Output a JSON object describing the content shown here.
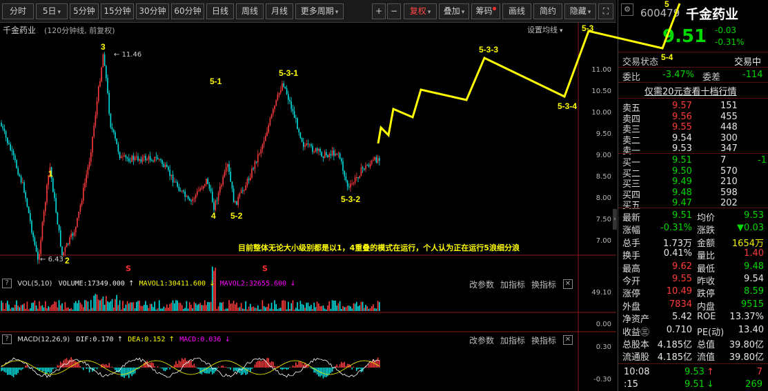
{
  "toolbar": {
    "periods": [
      "分时",
      "5日",
      "5分钟",
      "15分钟",
      "30分钟",
      "60分钟",
      "日线",
      "周线",
      "月线",
      "更多周期"
    ],
    "plus": "+",
    "minus": "−",
    "fuquan": "复权",
    "overlay": "叠加",
    "chips": "筹码",
    "draw": "画线",
    "simple": "简约",
    "hide": "隐藏",
    "expand_icon": "fullscreen-icon"
  },
  "chart": {
    "stock_name": "千金药业",
    "period_note": "(120分钟线, 前复权)",
    "set_ma": "设置均线",
    "price_axis": [
      "11.00",
      "10.50",
      "10.00",
      "9.50",
      "9.00",
      "8.50",
      "8.00",
      "7.50",
      "7.00"
    ],
    "high_label": "11.46",
    "low_label": "6.43",
    "signal_marker": "S",
    "comment": "目前整体无论大小级别都是以1，4重叠的模式在运行，个人认为正在运行5浪细分浪",
    "wave_labels": [
      "1",
      "2",
      "3",
      "4",
      "5",
      "5-1",
      "5-2",
      "5-3",
      "5-3-1",
      "5-3-2",
      "5-3-3",
      "5-3-4",
      "5-4"
    ],
    "line_color": "#ffff00",
    "up_color": "#ff3b3b",
    "down_color": "#00e0e0"
  },
  "vol": {
    "name": "VOL(5,10)",
    "volume_label": "VOLUME:17349.000",
    "mavol1": "MAVOL1:30411.600",
    "mavol2": "MAVOL2:32655.600",
    "axis_top": "49.10",
    "axis_bottom": "0.00",
    "btn_params": "改参数",
    "btn_add": "加指标",
    "btn_switch": "换指标",
    "close": "✕"
  },
  "macd": {
    "name": "MACD(12,26,9)",
    "dif": "DIF:0.170",
    "dea": "DEA:0.152",
    "macd": "MACD:0.036",
    "axis_top": "0.30",
    "axis_bottom": "-0.30",
    "btn_params": "改参数",
    "btn_add": "加指标",
    "btn_switch": "换指标",
    "close": "✕"
  },
  "quote": {
    "code": "600479",
    "name": "千金药业",
    "price": "9.51",
    "change": "-0.03",
    "change_pct": "-0.31%",
    "status_label": "交易状态",
    "status_value": "交易中",
    "weibi_label": "委比",
    "weibi_value": "-3.47%",
    "weicha_label": "委差",
    "weicha_value": "-114",
    "promo": "仅需20元查看十档行情",
    "asks": [
      {
        "label": "卖五",
        "price": "9.57",
        "vol": "151"
      },
      {
        "label": "卖四",
        "price": "9.56",
        "vol": "455"
      },
      {
        "label": "卖三",
        "price": "9.55",
        "vol": "448"
      },
      {
        "label": "卖二",
        "price": "9.54",
        "vol": "300"
      },
      {
        "label": "卖一",
        "price": "9.53",
        "vol": "347"
      }
    ],
    "bids": [
      {
        "label": "买一",
        "price": "9.51",
        "vol": "7",
        "delta": "-1"
      },
      {
        "label": "买二",
        "price": "9.50",
        "vol": "570",
        "delta": ""
      },
      {
        "label": "买三",
        "price": "9.49",
        "vol": "210",
        "delta": ""
      },
      {
        "label": "买四",
        "price": "9.48",
        "vol": "598",
        "delta": ""
      },
      {
        "label": "买五",
        "price": "9.47",
        "vol": "202",
        "delta": ""
      }
    ],
    "stats": [
      {
        "l1": "最新",
        "v1": "9.51",
        "c1": "dn",
        "l2": "均价",
        "v2": "9.53",
        "c2": "dn"
      },
      {
        "l1": "涨幅",
        "v1": "-0.31%",
        "c1": "dn",
        "l2": "涨跌",
        "v2": "▼0.03",
        "c2": "dn"
      },
      {
        "l1": "总手",
        "v1": "1.73万",
        "c1": "wh",
        "l2": "金额",
        "v2": "1654万",
        "c2": "yl"
      },
      {
        "l1": "换手",
        "v1": "0.41%",
        "c1": "wh",
        "l2": "量比",
        "v2": "1.40",
        "c2": "up"
      },
      {
        "l1": "最高",
        "v1": "9.62",
        "c1": "up",
        "l2": "最低",
        "v2": "9.48",
        "c2": "dn"
      },
      {
        "l1": "今开",
        "v1": "9.55",
        "c1": "up",
        "l2": "昨收",
        "v2": "9.54",
        "c2": "wh"
      },
      {
        "l1": "涨停",
        "v1": "10.49",
        "c1": "up",
        "l2": "跌停",
        "v2": "8.59",
        "c2": "dn"
      },
      {
        "l1": "外盘",
        "v1": "7834",
        "c1": "up",
        "l2": "内盘",
        "v2": "9515",
        "c2": "dn"
      },
      {
        "l1": "净资产",
        "v1": "5.42",
        "c1": "wh",
        "l2": "ROE",
        "v2": "13.37%",
        "c2": "wh"
      },
      {
        "l1": "收益㊂",
        "v1": "0.710",
        "c1": "wh",
        "l2": "PE(动)",
        "v2": "13.40",
        "c2": "wh"
      },
      {
        "l1": "总股本",
        "v1": "4.185亿",
        "c1": "wh",
        "l2": "总值",
        "v2": "39.80亿",
        "c2": "wh"
      },
      {
        "l1": "流通股",
        "v1": "4.185亿",
        "c1": "wh",
        "l2": "流值",
        "v2": "39.80亿",
        "c2": "wh"
      }
    ],
    "ticks": [
      {
        "time": "10:08",
        "price": "9.53",
        "arrow": "↑",
        "vol": "7"
      },
      {
        "time": ":15",
        "price": "9.51",
        "arrow": "↓",
        "vol": "269"
      }
    ]
  }
}
